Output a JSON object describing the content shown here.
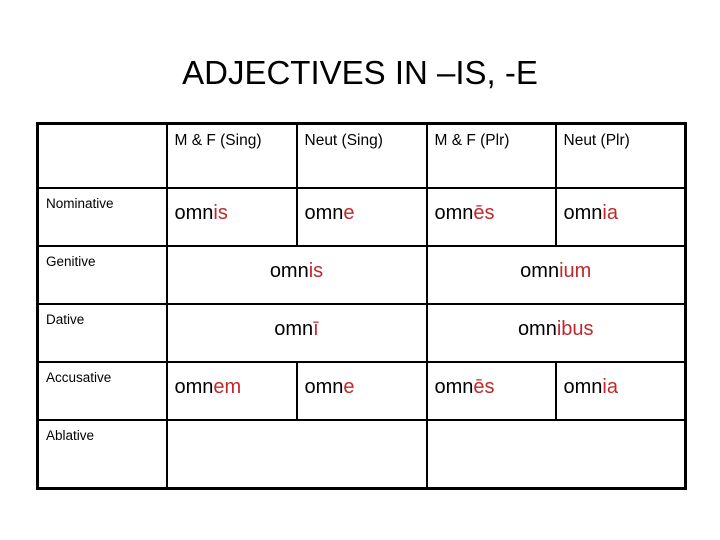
{
  "slide": {
    "title": "ADJECTIVES IN –IS, -E",
    "accent_color": "#C0282D",
    "text_color": "#000000",
    "background_color": "#FFFFFF"
  },
  "table": {
    "corner_label": "",
    "column_headers": [
      "M & F (Sing)",
      "Neut (Sing)",
      "M & F (Plr)",
      "Neut (Plr)"
    ],
    "row_labels": [
      "Nominative",
      "Genitive",
      "Dative",
      "Accusative",
      "Ablative"
    ],
    "rows": {
      "nominative": {
        "label": "Nominative",
        "mf_sing_stem": "omn",
        "mf_sing_ending": "is",
        "neut_sing_stem": "omn",
        "neut_sing_ending": "e",
        "mf_plr_stem": "omn",
        "mf_plr_ending": "ēs",
        "neut_plr_stem": "omn",
        "neut_plr_ending": "ia"
      },
      "genitive": {
        "label": "Genitive",
        "sing_stem": "omn",
        "sing_ending": "is",
        "plr_stem": "omn",
        "plr_ending": "ium"
      },
      "dative": {
        "label": "Dative",
        "sing_stem": "omn",
        "sing_ending": "ī",
        "plr_stem": "omn",
        "plr_ending": "ibus"
      },
      "accusative": {
        "label": "Accusative",
        "mf_sing_stem": "omn",
        "mf_sing_ending": "em",
        "neut_sing_stem": "omn",
        "neut_sing_ending": "e",
        "mf_plr_stem": "omn",
        "mf_plr_ending": "ēs",
        "neut_plr_stem": "omn",
        "neut_plr_ending": "ia"
      },
      "ablative": {
        "label": "Ablative",
        "sing_stem": "",
        "sing_ending": "",
        "plr_stem": "",
        "plr_ending": ""
      }
    }
  }
}
